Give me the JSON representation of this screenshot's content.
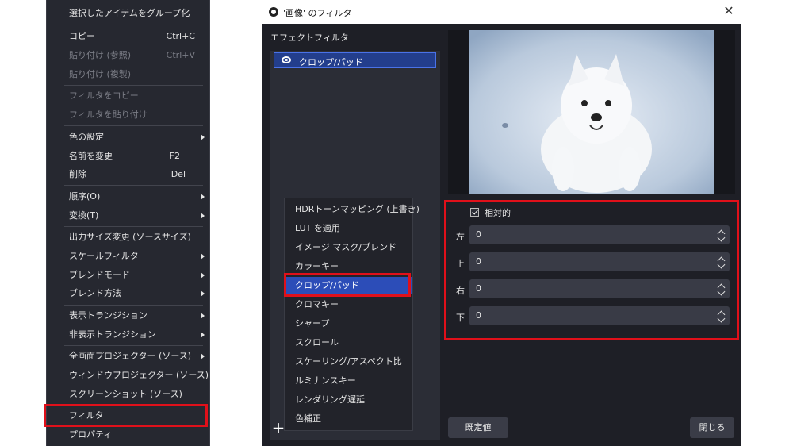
{
  "context_menu": {
    "items": [
      {
        "label": "選択したアイテムをグループ化",
        "shortcut": "",
        "disabled": false,
        "submenu": false
      },
      {
        "label": "コピー",
        "shortcut": "Ctrl+C",
        "disabled": false,
        "submenu": false
      },
      {
        "label": "貼り付け (参照)",
        "shortcut": "Ctrl+V",
        "disabled": true,
        "submenu": false
      },
      {
        "label": "貼り付け (複製)",
        "shortcut": "",
        "disabled": true,
        "submenu": false
      },
      {
        "label": "フィルタをコピー",
        "shortcut": "",
        "disabled": true,
        "submenu": false
      },
      {
        "label": "フィルタを貼り付け",
        "shortcut": "",
        "disabled": true,
        "submenu": false
      },
      {
        "label": "色の設定",
        "shortcut": "",
        "disabled": false,
        "submenu": true
      },
      {
        "label": "名前を変更",
        "shortcut": "F2",
        "disabled": false,
        "submenu": false
      },
      {
        "label": "削除",
        "shortcut": "Del",
        "disabled": false,
        "submenu": false
      },
      {
        "label": "順序(O)",
        "shortcut": "",
        "disabled": false,
        "submenu": true
      },
      {
        "label": "変換(T)",
        "shortcut": "",
        "disabled": false,
        "submenu": true
      },
      {
        "label": "出力サイズ変更 (ソースサイズ)",
        "shortcut": "",
        "disabled": false,
        "submenu": false
      },
      {
        "label": "スケールフィルタ",
        "shortcut": "",
        "disabled": false,
        "submenu": true
      },
      {
        "label": "ブレンドモード",
        "shortcut": "",
        "disabled": false,
        "submenu": true
      },
      {
        "label": "ブレンド方法",
        "shortcut": "",
        "disabled": false,
        "submenu": true
      },
      {
        "label": "表示トランジション",
        "shortcut": "",
        "disabled": false,
        "submenu": true
      },
      {
        "label": "非表示トランジション",
        "shortcut": "",
        "disabled": false,
        "submenu": true
      },
      {
        "label": "全画面プロジェクター (ソース)",
        "shortcut": "",
        "disabled": false,
        "submenu": true
      },
      {
        "label": "ウィンドウプロジェクター (ソース)",
        "shortcut": "",
        "disabled": false,
        "submenu": false
      },
      {
        "label": "スクリーンショット (ソース)",
        "shortcut": "",
        "disabled": false,
        "submenu": false
      },
      {
        "label": "フィルタ",
        "shortcut": "",
        "disabled": false,
        "submenu": false
      },
      {
        "label": "プロパティ",
        "shortcut": "",
        "disabled": false,
        "submenu": false
      }
    ]
  },
  "dialog": {
    "title": "'画像' のフィルタ",
    "close_glyph": "✕",
    "effects_header": "エフェクトフィルタ",
    "filters": [
      {
        "label": "クロップ/パッド"
      }
    ],
    "props": {
      "relative_label": "相対的",
      "relative_checked": true,
      "fields": [
        {
          "label": "左",
          "value": "0"
        },
        {
          "label": "上",
          "value": "0"
        },
        {
          "label": "右",
          "value": "0"
        },
        {
          "label": "下",
          "value": "0"
        }
      ]
    },
    "defaults_button": "既定値",
    "close_button": "閉じる",
    "add_glyph": "+"
  },
  "add_filter_menu": {
    "items": [
      {
        "label": "HDRトーンマッピング (上書き)",
        "active": false
      },
      {
        "label": "LUT を適用",
        "active": false
      },
      {
        "label": "イメージ マスク/ブレンド",
        "active": false
      },
      {
        "label": "カラーキー",
        "active": false
      },
      {
        "label": "クロップ/パッド",
        "active": true
      },
      {
        "label": "クロマキー",
        "active": false
      },
      {
        "label": "シャープ",
        "active": false
      },
      {
        "label": "スクロール",
        "active": false
      },
      {
        "label": "スケーリング/アスペクト比",
        "active": false
      },
      {
        "label": "ルミナンスキー",
        "active": false
      },
      {
        "label": "レンダリング遅延",
        "active": false
      },
      {
        "label": "色補正",
        "active": false
      }
    ]
  },
  "colors": {
    "highlight_border": "#e0101a",
    "selection": "#2c4db8"
  }
}
